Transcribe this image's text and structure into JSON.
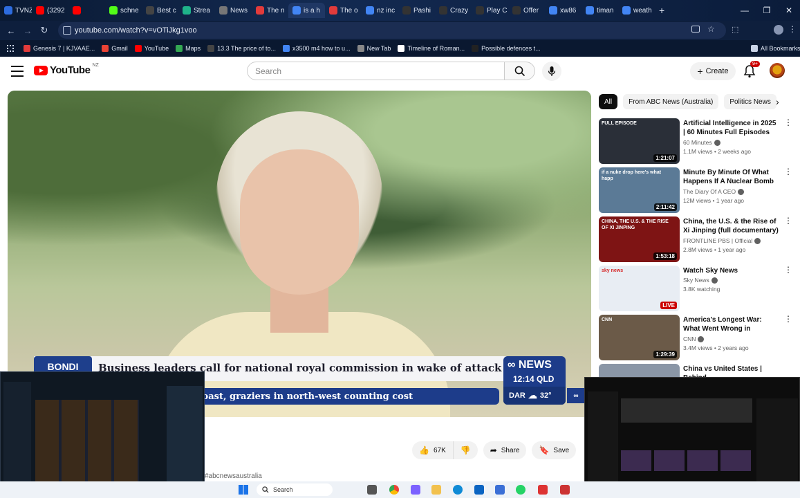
{
  "browser": {
    "tabs": [
      {
        "label": "TVNZ",
        "color": "#2d6cdf"
      },
      {
        "label": "(3292",
        "color": "#ff0000"
      },
      {
        "label": "",
        "color": "#ff0000"
      },
      {
        "label": "schne",
        "color": "#53fc18"
      },
      {
        "label": "Best c",
        "color": "#444444"
      },
      {
        "label": "Strea",
        "color": "#1fb38a"
      },
      {
        "label": "News",
        "color": "#777777"
      },
      {
        "label": "The n",
        "color": "#e23b3b"
      },
      {
        "label": "is a h",
        "color": "#4285f4"
      },
      {
        "label": "The o",
        "color": "#e23b3b"
      },
      {
        "label": "nz inc",
        "color": "#4285f4"
      },
      {
        "label": "Pashi",
        "color": "#333333"
      },
      {
        "label": "Crazy",
        "color": "#333333"
      },
      {
        "label": "Play C",
        "color": "#333333"
      },
      {
        "label": "Offer",
        "color": "#333333"
      },
      {
        "label": "xw86",
        "color": "#4285f4"
      },
      {
        "label": "timan",
        "color": "#4285f4"
      },
      {
        "label": "weath",
        "color": "#4285f4"
      }
    ],
    "new_tab": "+",
    "window_controls": {
      "minimize": "—",
      "maximize": "❐",
      "close": "✕"
    },
    "address": "youtube.com/watch?v=vOTiJkg1voo",
    "bookmarks": [
      {
        "label": "Genesis 7 | KJVAAE...",
        "color": "#e23b3b"
      },
      {
        "label": "Gmail",
        "color": "#ea4335"
      },
      {
        "label": "YouTube",
        "color": "#ff0000"
      },
      {
        "label": "Maps",
        "color": "#34a853"
      },
      {
        "label": "13.3 The price of to...",
        "color": "#444444"
      },
      {
        "label": "x3500 m4 how to u...",
        "color": "#4285f4"
      },
      {
        "label": "New Tab",
        "color": "#888888"
      },
      {
        "label": "Timeline of Roman...",
        "color": "#ffffff"
      },
      {
        "label": "Possible defences t...",
        "color": "#222222"
      }
    ],
    "all_bookmarks": "All Bookmarks"
  },
  "header": {
    "logo_text": "YouTube",
    "region": "NZ",
    "search_placeholder": "Search",
    "create_label": "Create",
    "notification_count": "9+"
  },
  "video": {
    "location_tag": "BONDI",
    "headline": "Business leaders call for national royal commission in wake of attack",
    "ticker": "d coast, graziers in north-west counting cost",
    "channel_brand": "NEWS",
    "time": "12:14 QLD",
    "weather_city": "DAR",
    "weather_temp": "32°"
  },
  "actions": {
    "like_count": "67K",
    "share_label": "Share",
    "save_label": "Save"
  },
  "description_tags": "#abcnewsaustralia",
  "chips": [
    "All",
    "From ABC News (Australia)",
    "Politics News"
  ],
  "recommendations": [
    {
      "title": "Artificial Intelligence in 2025 | 60 Minutes Full Episodes",
      "channel": "60 Minutes",
      "meta": "1.1M views • 2 weeks ago",
      "duration": "1:21:07",
      "badge": "FULL EPISODE",
      "thumb_color": "#2a2f38"
    },
    {
      "title": "Minute By Minute Of What Happens If A Nuclear Bomb ...",
      "channel": "The Diary Of A CEO",
      "meta": "12M views • 1 year ago",
      "duration": "2:11:42",
      "badge": "if a nuke drop here's what happ",
      "thumb_color": "#5b7a96"
    },
    {
      "title": "China, the U.S. & the Rise of Xi Jinping (full documentary) | ...",
      "channel": "FRONTLINE PBS | Official",
      "meta": "2.8M views • 1 year ago",
      "duration": "1:53:18",
      "badge": "CHINA, THE U.S. & THE RISE OF XI JINPING",
      "thumb_color": "#7e1414"
    },
    {
      "title": "Watch Sky News",
      "channel": "Sky News",
      "meta": "3.8K watching",
      "duration": "LIVE",
      "badge": "sky news",
      "thumb_color": "#e8edf3"
    },
    {
      "title": "America's Longest War: What Went Wrong in Afghanistan ...",
      "channel": "CNN",
      "meta": "3.4M views • 2 years ago",
      "duration": "1:29:39",
      "badge": "CNN",
      "thumb_color": "#6b5a48"
    },
    {
      "title": "China vs United States | Behind",
      "channel": "",
      "meta": "",
      "duration": "",
      "badge": "",
      "thumb_color": "#8a96a6"
    }
  ],
  "taskbar": {
    "search_label": "Search"
  }
}
